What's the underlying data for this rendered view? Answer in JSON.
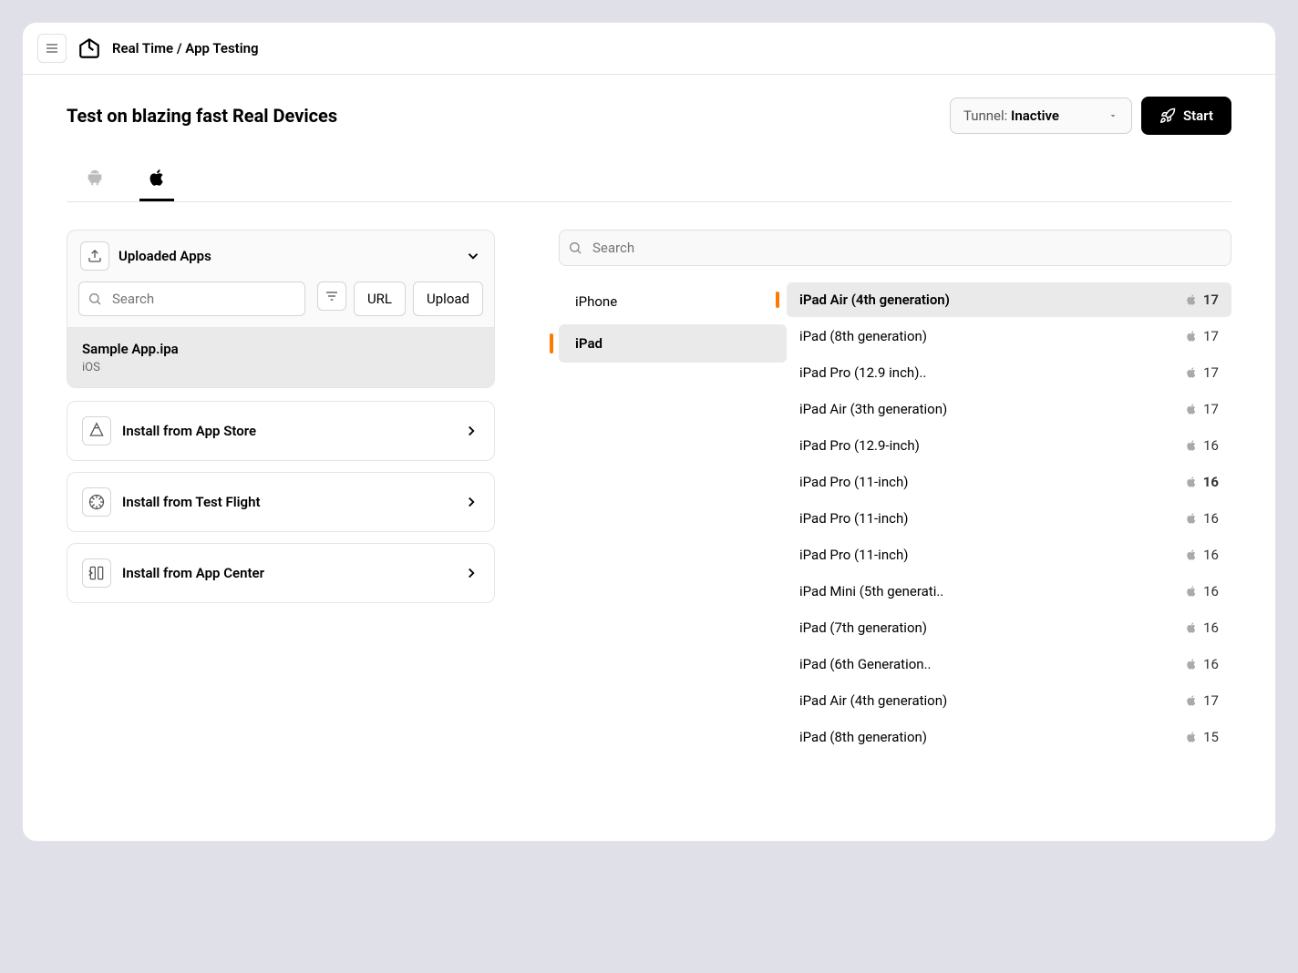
{
  "header": {
    "breadcrumb": "Real Time / App Testing"
  },
  "title": "Test on blazing fast Real Devices",
  "tunnel": {
    "label": "Tunnel:",
    "status": "Inactive"
  },
  "start_btn": "Start",
  "platform_tabs": [
    {
      "id": "android",
      "active": false
    },
    {
      "id": "apple",
      "active": true
    }
  ],
  "apps_panel": {
    "title": "Uploaded Apps",
    "search_placeholder": "Search",
    "url_btn": "URL",
    "upload_btn": "Upload",
    "apps": [
      {
        "name": "Sample App.ipa",
        "platform": "iOS"
      }
    ]
  },
  "install_sources": [
    {
      "title": "Install from App Store",
      "icon": "appstore"
    },
    {
      "title": "Install from Test Flight",
      "icon": "testflight"
    },
    {
      "title": "Install from App Center",
      "icon": "appcenter"
    }
  ],
  "device_search_placeholder": "Search",
  "device_types": [
    {
      "name": "iPhone",
      "active": false
    },
    {
      "name": "iPad",
      "active": true
    }
  ],
  "devices": [
    {
      "name": "iPad Air (4th generation)",
      "version": "17",
      "active": true
    },
    {
      "name": "iPad (8th generation)",
      "version": "17"
    },
    {
      "name": "iPad Pro (12.9 inch)..",
      "version": "17"
    },
    {
      "name": "iPad Air (3th generation)",
      "version": "17"
    },
    {
      "name": "iPad Pro (12.9-inch)",
      "version": "16"
    },
    {
      "name": "iPad Pro (11-inch)",
      "version": "16",
      "bold": true
    },
    {
      "name": "iPad Pro (11-inch)",
      "version": "16"
    },
    {
      "name": "iPad Pro (11-inch)",
      "version": "16"
    },
    {
      "name": "iPad Mini (5th generati..",
      "version": "16"
    },
    {
      "name": "iPad (7th generation)",
      "version": "16"
    },
    {
      "name": "iPad (6th Generation..",
      "version": "16"
    },
    {
      "name": "iPad Air (4th generation)",
      "version": "17"
    },
    {
      "name": "iPad (8th generation)",
      "version": "15"
    }
  ]
}
